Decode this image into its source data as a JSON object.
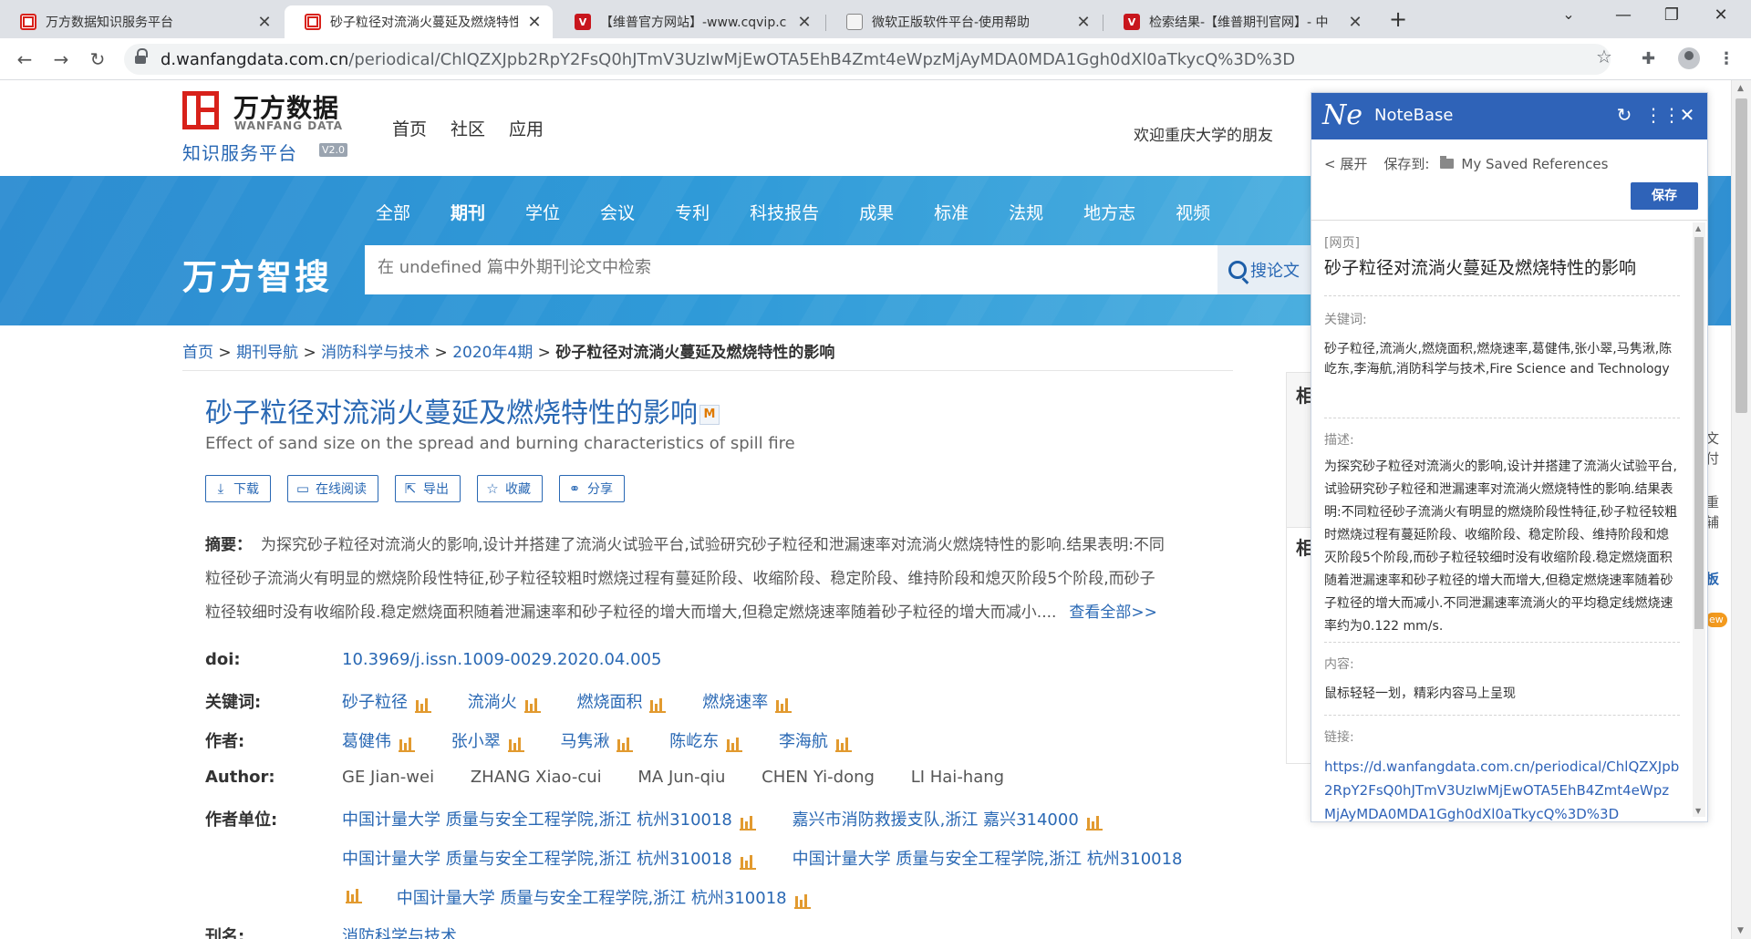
{
  "browser": {
    "tabs": [
      {
        "title": "万方数据知识服务平台",
        "favicon": "wanfang-icon"
      },
      {
        "title": "砂子粒径对流淌火蔓延及燃烧特性",
        "favicon": "wanfang-icon"
      },
      {
        "title": "【维普官方网站】-www.cqvip.c",
        "favicon": "cqvip-icon"
      },
      {
        "title": "微软正版软件平台-使用帮助",
        "favicon": "document-icon"
      },
      {
        "title": "检索结果-【维普期刊官网】- 中",
        "favicon": "cqvip-icon"
      }
    ],
    "url_host": "d.wanfangdata.com.cn",
    "url_path": "/periodical/ChlQZXJpb2RpY2FsQ0hJTmV3UzIwMjEwOTA5EhB4Zmt4eWpzMjAyMDA0MDA1Ggh0dXl0aTkycQ%3D%3D",
    "colors": {
      "accent": "#2968b4",
      "brand_red": "#d8211a",
      "notebase_blue": "#2f63b8"
    }
  },
  "site": {
    "logo_cn": "万方数据",
    "logo_en": "WANFANG DATA",
    "logo_sub": "知识服务平台",
    "logo_version": "V2.0",
    "nav": [
      "首页",
      "社区",
      "应用"
    ],
    "welcome": "欢迎重庆大学的朋友"
  },
  "banner": {
    "categories": [
      "全部",
      "期刊",
      "学位",
      "会议",
      "专利",
      "科技报告",
      "成果",
      "标准",
      "法规",
      "地方志",
      "视频"
    ],
    "active_category": "期刊",
    "brand": "万方智搜",
    "search_placeholder": "在 undefined 篇中外期刊论文中检索",
    "search_button": "搜论文"
  },
  "breadcrumb": [
    "首页",
    "期刊导航",
    "消防科学与技术",
    "2020年4期",
    "砂子粒径对流淌火蔓延及燃烧特性的影响"
  ],
  "article": {
    "title": "砂子粒径对流淌火蔓延及燃烧特性的影响",
    "title_badge": "M",
    "subtitle": "Effect of sand size on the spread and burning characteristics of spill fire",
    "actions": [
      {
        "label": "下载",
        "icon": "download-icon"
      },
      {
        "label": "在线阅读",
        "icon": "book-icon"
      },
      {
        "label": "导出",
        "icon": "export-icon"
      },
      {
        "label": "收藏",
        "icon": "star-icon"
      },
      {
        "label": "分享",
        "icon": "share-icon"
      }
    ],
    "abstract_label": "摘要：",
    "abstract_lines": [
      "为探究砂子粒径对流淌火的影响,设计并搭建了流淌火试验平台,试验研究砂子粒径和泄漏速率对流淌火燃烧特性的影响.结果表明:不同",
      "粒径砂子流淌火有明显的燃烧阶段性特征,砂子粒径较粗时燃烧过程有蔓延阶段、收缩阶段、稳定阶段、维持阶段和熄灭阶段5个阶段,而砂子",
      "粒径较细时没有收缩阶段.稳定燃烧面积随着泄漏速率和砂子粒径的增大而增大,但稳定燃烧速率随着砂子粒径的增大而减小...."
    ],
    "view_all": "查看全部>>",
    "doi_label": "doi:",
    "doi": "10.3969/j.issn.1009-0029.2020.04.005",
    "keywords_label": "关键词:",
    "keywords": [
      "砂子粒径",
      "流淌火",
      "燃烧面积",
      "燃烧速率"
    ],
    "authors_label": "作者:",
    "authors": [
      "葛健伟",
      "张小翠",
      "马隽湫",
      "陈屹东",
      "李海航"
    ],
    "author_en_label": "Author:",
    "authors_en": [
      "GE Jian-wei",
      "ZHANG Xiao-cui",
      "MA Jun-qiu",
      "CHEN Yi-dong",
      "LI Hai-hang"
    ],
    "affil_label": "作者单位:",
    "affiliations": [
      "中国计量大学 质量与安全工程学院,浙江 杭州310018",
      "嘉兴市消防救援支队,浙江 嘉兴314000",
      "中国计量大学 质量与安全工程学院,浙江 杭州310018",
      "中国计量大学 质量与安全工程学院,浙江 杭州310018",
      "中国计量大学 质量与安全工程学院,浙江 杭州310018"
    ],
    "journal_label": "刊名:",
    "journal": "消防科学与技术"
  },
  "right_sidebar": {
    "heads": [
      "相",
      "相"
    ],
    "snippets": [
      "文",
      "付",
      "重",
      "辅",
      "板",
      "ew"
    ]
  },
  "notebase": {
    "logo": "Ne",
    "name": "NoteBase",
    "expand": "< 展开",
    "save_to_label": "保存到:",
    "folder": "My Saved References",
    "save_button": "保存",
    "type": "[网页]",
    "title": "砂子粒径对流淌火蔓延及燃烧特性的影响",
    "keywords_label": "关键词:",
    "keywords": "砂子粒径,流淌火,燃烧面积,燃烧速率,葛健伟,张小翠,马隽湫,陈屹东,李海航,消防科学与技术,Fire Science and Technology",
    "desc_label": "描述:",
    "description": "为探究砂子粒径对流淌火的影响,设计并搭建了流淌火试验平台,试验研究砂子粒径和泄漏速率对流淌火燃烧特性的影响.结果表明:不同粒径砂子流淌火有明显的燃烧阶段性特征,砂子粒径较粗时燃烧过程有蔓延阶段、收缩阶段、稳定阶段、维持阶段和熄灭阶段5个阶段,而砂子粒径较细时没有收缩阶段.稳定燃烧面积随着泄漏速率和砂子粒径的增大而增大,但稳定燃烧速率随着砂子粒径的增大而减小.不同泄漏速率流淌火的平均稳定线燃烧速率约为0.122 mm/s.",
    "content_label": "内容:",
    "content": "鼠标轻轻一划，精彩内容马上呈现",
    "link_label": "链接:",
    "link": "https://d.wanfangdata.com.cn/periodical/ChlQZXJpb2RpY2FsQ0hJTmV3UzIwMjEwOTA5EhB4Zmt4eWpzMjAyMDA0MDA1Ggh0dXl0aTkycQ%3D%3D"
  }
}
